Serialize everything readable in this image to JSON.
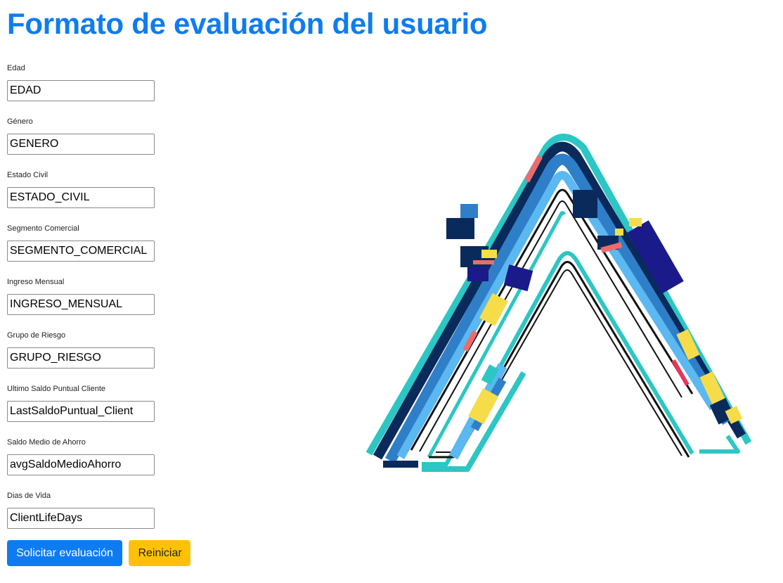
{
  "page": {
    "title": "Formato de evaluación del usuario"
  },
  "form": {
    "fields": [
      {
        "label": "Edad",
        "value": "EDAD"
      },
      {
        "label": "Género",
        "value": "GENERO"
      },
      {
        "label": "Estado Civil",
        "value": "ESTADO_CIVIL"
      },
      {
        "label": "Segmento Comercial",
        "value": "SEGMENTO_COMERCIAL"
      },
      {
        "label": "Ingreso Mensual",
        "value": "INGRESO_MENSUAL"
      },
      {
        "label": "Grupo de Riesgo",
        "value": "GRUPO_RIESGO"
      },
      {
        "label": "Ultimo Saldo Puntual Cliente",
        "value": "LastSaldoPuntual_Client"
      },
      {
        "label": "Saldo Medio de Ahorro",
        "value": "avgSaldoMedioAhorro"
      },
      {
        "label": "Dias de Vida",
        "value": "ClientLifeDays"
      }
    ]
  },
  "actions": {
    "submit_label": "Solicitar evaluación",
    "reset_label": "Reiniciar"
  },
  "colors": {
    "primary": "#0d7cf2",
    "warning": "#ffc107",
    "logo_navy": "#0a2a5c",
    "logo_blue": "#2f7fc8",
    "logo_lightblue": "#5bb8f0",
    "logo_teal": "#2cc6c4",
    "logo_yellow": "#f7dc4a",
    "logo_red": "#ee6b6b",
    "logo_indigo": "#1a1a8a"
  },
  "logo": {
    "icon": "abstract-a-logo"
  }
}
